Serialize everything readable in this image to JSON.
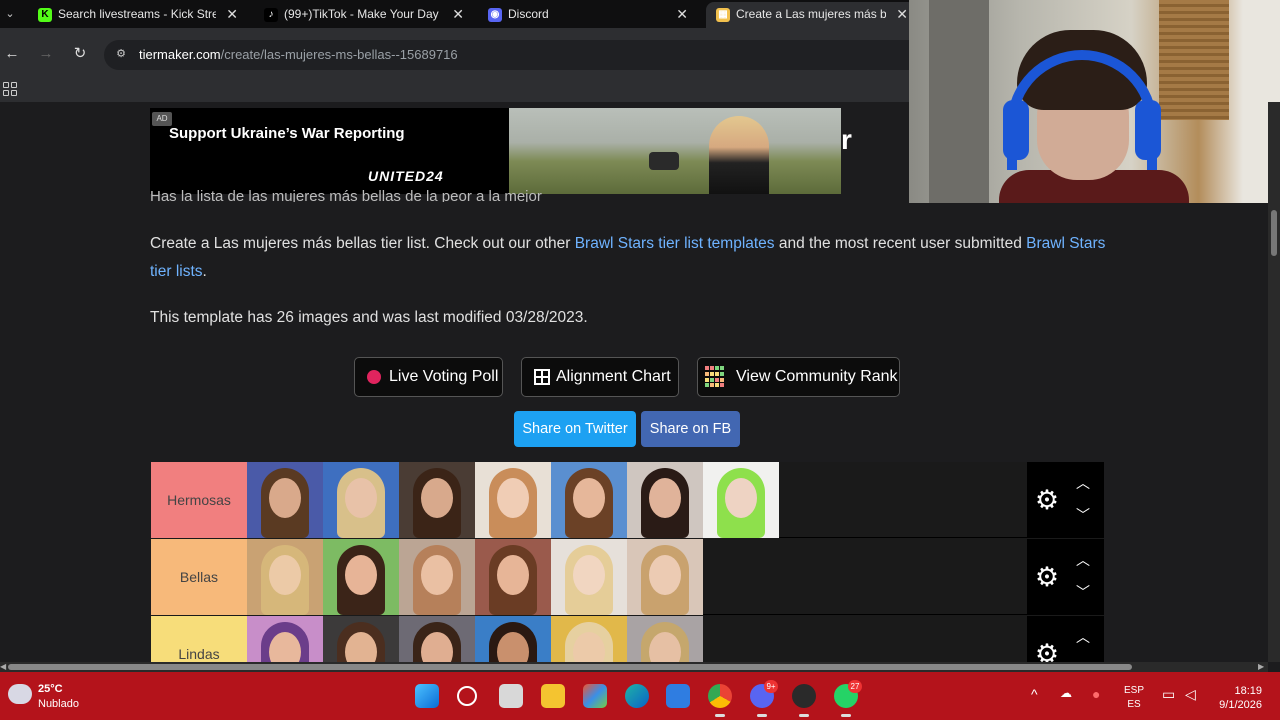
{
  "browser": {
    "tabs": [
      {
        "title": "Search livestreams - Kick Strea",
        "favicon": "kick-icon",
        "color": "#53fc18",
        "glyph": "K",
        "active": false
      },
      {
        "title": "(99+)TikTok - Make Your Day",
        "favicon": "tiktok-icon",
        "color": "#000000",
        "glyph": "♪",
        "active": false
      },
      {
        "title": "Discord",
        "favicon": "discord-icon",
        "color": "#5865f2",
        "glyph": "◉",
        "active": false
      },
      {
        "title": "Create a Las mujeres más bellas",
        "favicon": "tiermaker-icon",
        "color": "#f2c14e",
        "glyph": "▦",
        "active": true
      }
    ],
    "url_domain": "tiermaker.com",
    "url_path": "/create/las-mujeres-ms-bellas--15689716"
  },
  "ad": {
    "badge": "AD",
    "title": "Support Ukraine’s War Reporting",
    "brand": "UNITED24",
    "trailing_char": "r"
  },
  "page": {
    "desc_cut": "Has la lista de las mujeres más bellas de la peor a la mejor",
    "desc_1": "Create a Las mujeres más bellas tier list. Check out our other ",
    "desc_link_1": "Brawl Stars tier list templates",
    "desc_2": " and the most recent user submitted ",
    "desc_link_2": "Brawl Stars tier lists",
    "desc_3": ".",
    "info": "This template has 26 images and was last modified 03/28/2023.",
    "buttons": {
      "live_poll": "Live Voting Poll",
      "alignment": "Alignment Chart",
      "community_rank": "View Community Rank"
    },
    "share": {
      "twitter": "Share on Twitter",
      "twitter_color": "#1da1f2",
      "fb": "Share on FB",
      "fb_color": "#4267b2"
    }
  },
  "tiers": [
    {
      "label": "Hermosas",
      "color": "#f17f7f",
      "items": [
        {
          "bg": "#4a5aa8",
          "skin": "#d9a98b",
          "hair": "#5a3a22"
        },
        {
          "bg": "#3e6fc0",
          "skin": "#e8c2a8",
          "hair": "#d8c08a"
        },
        {
          "bg": "#4a3c34",
          "skin": "#d8a98c",
          "hair": "#3b2417"
        },
        {
          "bg": "#e8e0d6",
          "skin": "#f0cdb5",
          "hair": "#c98d5a"
        },
        {
          "bg": "#5a8fd0",
          "skin": "#e6b79a",
          "hair": "#6b4126"
        },
        {
          "bg": "#cfc6c0",
          "skin": "#e0b39a",
          "hair": "#2a1b16"
        },
        {
          "bg": "#f1f1ef",
          "skin": "#eed3c3",
          "hair": "#8ee04c"
        }
      ]
    },
    {
      "label": "Bellas",
      "color": "#f7b97a",
      "items": [
        {
          "bg": "#c9a273",
          "skin": "#eccaa7",
          "hair": "#d6b77a"
        },
        {
          "bg": "#7dbb63",
          "skin": "#e7b497",
          "hair": "#3b2418"
        },
        {
          "bg": "#bba594",
          "skin": "#eac0a3",
          "hair": "#b6805a"
        },
        {
          "bg": "#9a5a4c",
          "skin": "#e7b597",
          "hair": "#6a3c24"
        },
        {
          "bg": "#e6e0da",
          "skin": "#f1d6c1",
          "hair": "#e5cd98"
        },
        {
          "bg": "#d9c6b8",
          "skin": "#eccbb3",
          "hair": "#c9a26e"
        }
      ]
    },
    {
      "label": "Lindas",
      "color": "#f7dd7a",
      "items": [
        {
          "bg": "#c88ec9",
          "skin": "#e8b89c",
          "hair": "#6b3d8a"
        },
        {
          "bg": "#3c3a3a",
          "skin": "#e2b392",
          "hair": "#4b2e1f"
        },
        {
          "bg": "#6d6a74",
          "skin": "#e0ae91",
          "hair": "#3a2418"
        },
        {
          "bg": "#3a7ec7",
          "skin": "#c9906d",
          "hair": "#2a1912"
        },
        {
          "bg": "#e1b84a",
          "skin": "#eccaa9",
          "hair": "#e6d0a0"
        },
        {
          "bg": "#a9a3a4",
          "skin": "#e6c0a4",
          "hair": "#c5a76d"
        }
      ]
    }
  ],
  "taskbar": {
    "temp": "25°C",
    "weather": "Nublado",
    "lang_1": "ESP",
    "lang_2": "ES",
    "time": "18:19",
    "date": "9/1/2026",
    "discord_badge": "9+",
    "whatsapp_badge": "27"
  }
}
